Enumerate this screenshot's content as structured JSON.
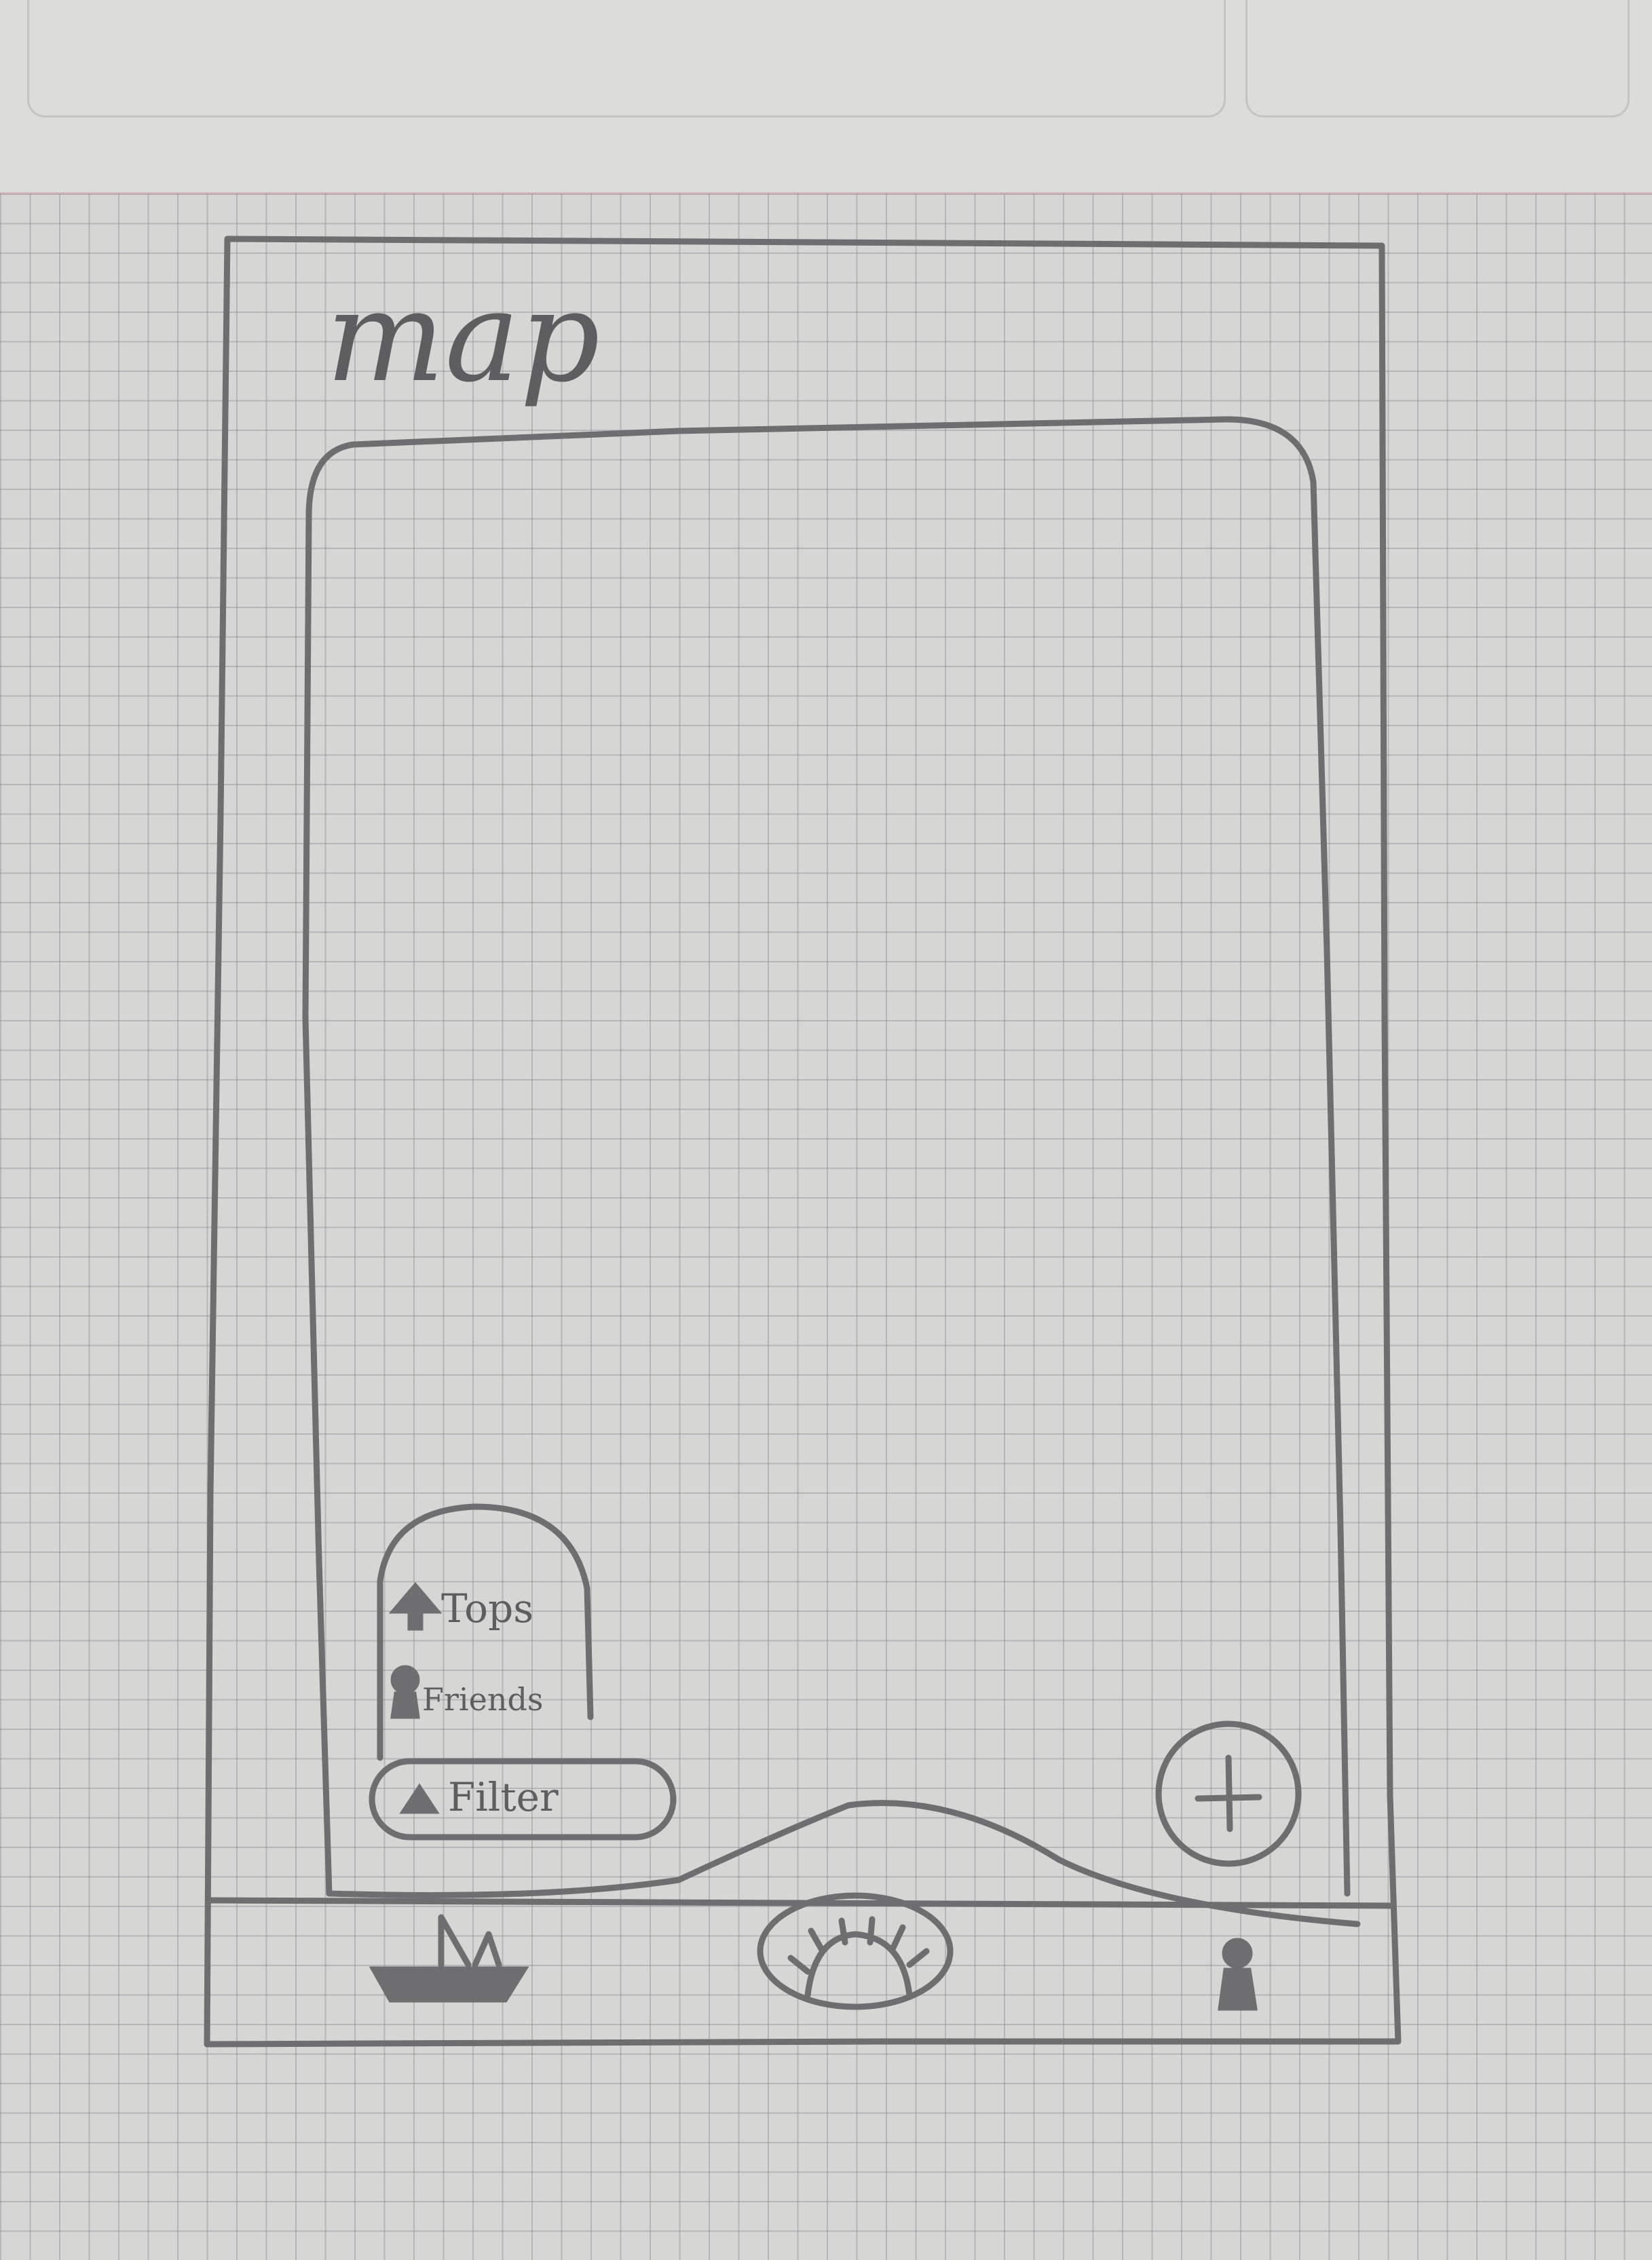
{
  "header": {
    "title": "map"
  },
  "filter_menu": {
    "items": [
      {
        "label": "Tops",
        "icon": "up-arrow-icon"
      },
      {
        "label": "Friends",
        "icon": "person-icon"
      }
    ],
    "button_label": "Filter",
    "button_icon": "triangle-icon"
  },
  "add_button": {
    "label": "+"
  },
  "bottom_nav": {
    "items": [
      {
        "icon": "boat-icon"
      },
      {
        "icon": "sunrise-icon"
      },
      {
        "icon": "person-icon"
      }
    ]
  }
}
